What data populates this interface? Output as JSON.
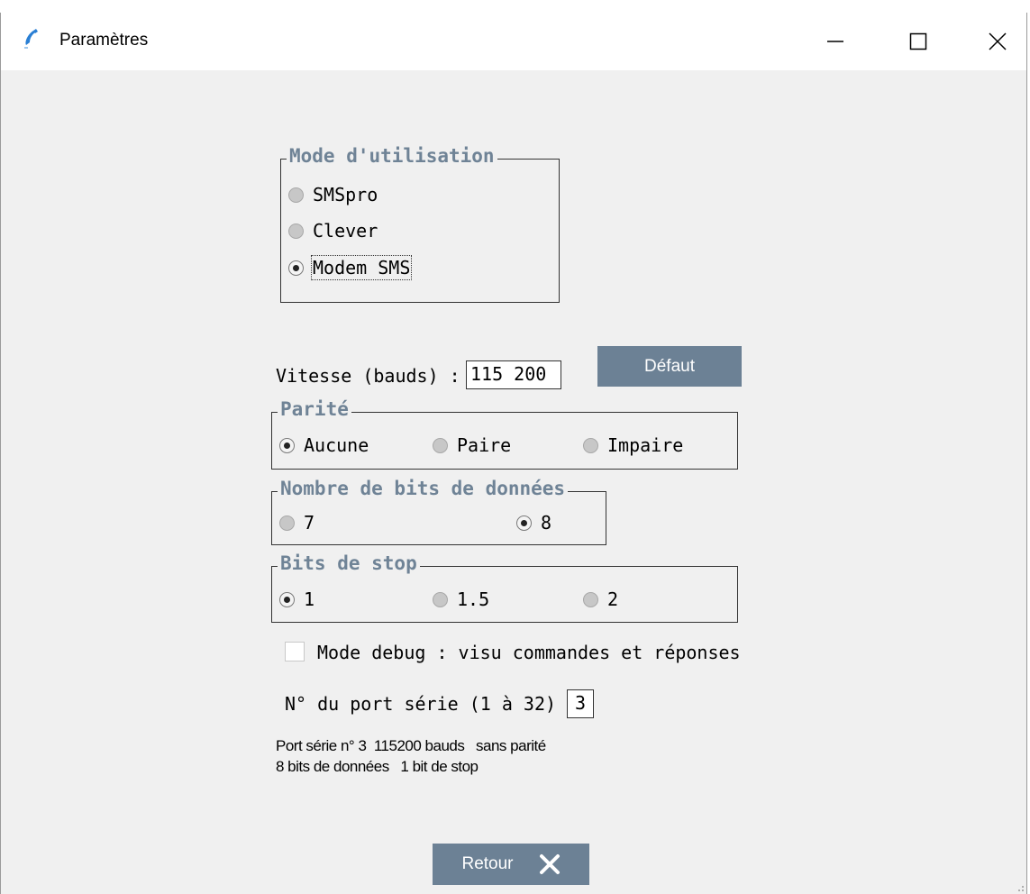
{
  "window": {
    "title": "Paramètres"
  },
  "mode_group": {
    "legend": "Mode d'utilisation",
    "options": [
      "SMSpro",
      "Clever",
      "Modem SMS"
    ],
    "selected": "Modem SMS"
  },
  "speed": {
    "label": "Vitesse (bauds) :",
    "value": "115 200"
  },
  "default_button": {
    "label": "Défaut"
  },
  "parity_group": {
    "legend": "Parité",
    "options": [
      "Aucune",
      "Paire",
      "Impaire"
    ],
    "selected": "Aucune"
  },
  "databits_group": {
    "legend": "Nombre de bits de données",
    "options": [
      "7",
      "8"
    ],
    "selected": "8"
  },
  "stopbits_group": {
    "legend": "Bits de stop",
    "options": [
      "1",
      "1.5",
      "2"
    ],
    "selected": "1"
  },
  "debug": {
    "label": "Mode debug : visu commandes et réponses",
    "checked": false
  },
  "port": {
    "label": "N° du port série (1 à 32) :",
    "value": "3"
  },
  "summary": {
    "line1": "Port série n° 3  115200 bauds   sans parité",
    "line2": "8 bits de données   1 bit de stop"
  },
  "back_button": {
    "label": "Retour"
  },
  "colors": {
    "accent": "#6c8195",
    "legend": "#6f8396"
  }
}
